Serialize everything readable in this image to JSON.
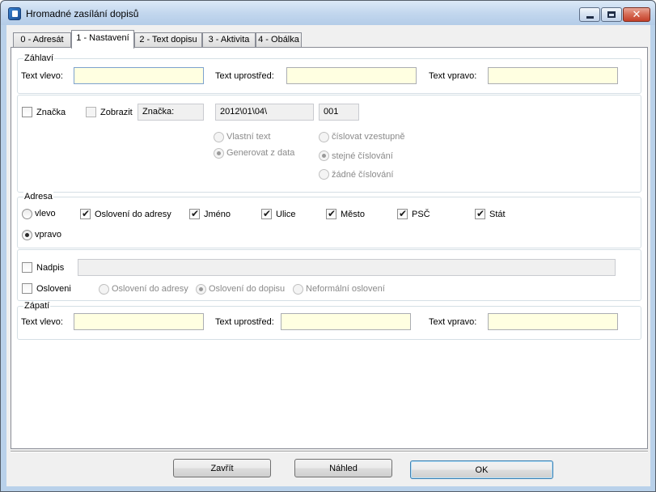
{
  "window": {
    "title": "Hromadné zasílání dopisů"
  },
  "tabs": [
    {
      "label": "0 - Adresát"
    },
    {
      "label": "1 - Nastavení"
    },
    {
      "label": "2 - Text dopisu"
    },
    {
      "label": "3 - Aktivita"
    },
    {
      "label": "4 - Obálka"
    }
  ],
  "header": {
    "legend": "Záhlaví",
    "left_label": "Text vlevo:",
    "center_label": "Text uprostřed:",
    "right_label": "Text vpravo:",
    "left_value": "",
    "center_value": "",
    "right_value": ""
  },
  "mark": {
    "checkbox_label": "Značka",
    "show_label": "Zobrazit",
    "field_label": "Značka:",
    "date_value": "2012\\01\\04\\",
    "number_value": "001",
    "own_text": "Vlastní text",
    "generate_from_data": "Generovat z data",
    "numbering_ascending": "číslovat vzestupně",
    "numbering_same": "stejné číslování",
    "numbering_none": "žádné číslování"
  },
  "address": {
    "legend": "Adresa",
    "left": "vlevo",
    "right": "vpravo",
    "salutation": "Oslovení do adresy",
    "name": "Jméno",
    "street": "Ulice",
    "city": "Město",
    "zip": "PSČ",
    "country": "Stát"
  },
  "caption": {
    "caption_label": "Nadpis",
    "caption_value": "",
    "salutation_label": "Osloveni",
    "sal_address": "Oslovení do adresy",
    "sal_letter": "Oslovení do dopisu",
    "sal_informal": "Neformální oslovení"
  },
  "footer": {
    "legend": "Zápatí",
    "left_label": "Text vlevo:",
    "center_label": "Text uprostřed:",
    "right_label": "Text vpravo:",
    "left_value": "",
    "center_value": "",
    "right_value": ""
  },
  "buttons": {
    "close": "Zavřít",
    "preview": "Náhled",
    "ok": "OK"
  },
  "colors": {
    "input_bg": "#ffffe1",
    "titlebar": "#c3d7ee"
  }
}
